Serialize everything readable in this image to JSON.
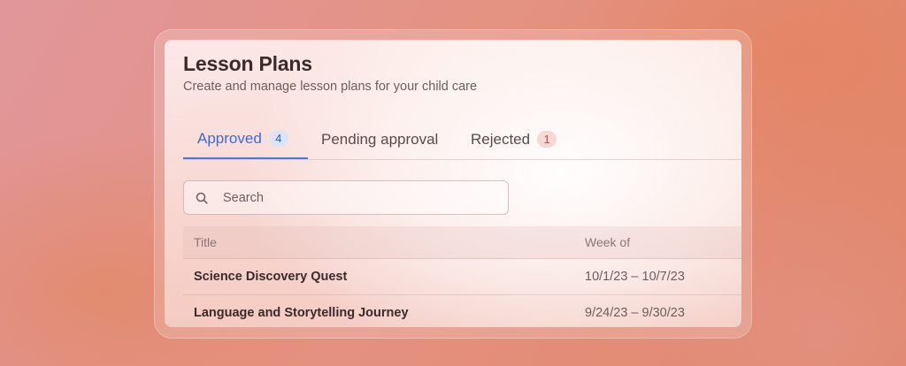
{
  "page": {
    "title": "Lesson Plans",
    "subtitle": "Create and manage lesson plans for your child care"
  },
  "tabs": [
    {
      "label": "Approved",
      "count": "4",
      "active": true
    },
    {
      "label": "Pending approval",
      "active": false
    },
    {
      "label": "Rejected",
      "count": "1",
      "active": false
    }
  ],
  "search": {
    "placeholder": "Search",
    "icon": "search-icon"
  },
  "table": {
    "columns": [
      "Title",
      "Week of"
    ],
    "rows": [
      {
        "title": "Science Discovery Quest",
        "week": "10/1/23 – 10/7/23"
      },
      {
        "title": "Language and Storytelling Journey",
        "week": "9/24/23 – 9/30/23"
      }
    ]
  },
  "colors": {
    "accent": "#3e6ad8",
    "approved_badge_bg": "#dde4f6",
    "rejected_badge_bg": "#f6d8d4",
    "rejected_badge_text": "#c0504a"
  }
}
